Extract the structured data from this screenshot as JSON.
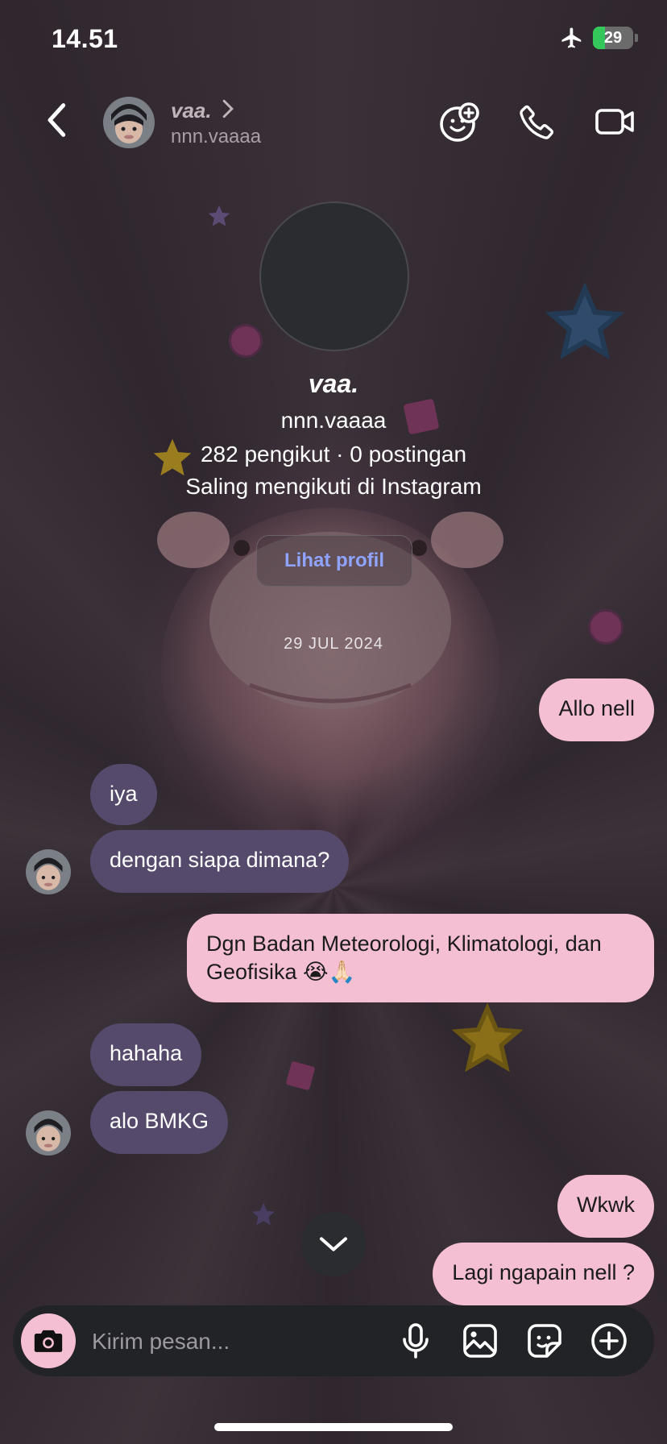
{
  "status_bar": {
    "time": "14.51",
    "battery": "29"
  },
  "header": {
    "name": "vaa.",
    "username": "nnn.vaaaa"
  },
  "profile": {
    "name": "vaa.",
    "username": "nnn.vaaaa",
    "stats": "282 pengikut · 0 postingan",
    "mutual": "Saling mengikuti di Instagram",
    "view_profile_label": "Lihat profil"
  },
  "date_separator": "29 JUL 2024",
  "messages": [
    {
      "sender": "me",
      "text": "Allo nell"
    },
    {
      "sender": "them",
      "text": "iya"
    },
    {
      "sender": "them",
      "text": "dengan siapa dimana?"
    },
    {
      "sender": "me",
      "line1": "Dgn Badan Meteorologi, Klimatologi, dan",
      "line2": "Geofisika 😭🙏🏻"
    },
    {
      "sender": "them",
      "text": "hahaha"
    },
    {
      "sender": "them",
      "text": "alo BMKG"
    },
    {
      "sender": "me",
      "text": "Wkwk"
    },
    {
      "sender": "me",
      "text": "Lagi ngapain nell ?"
    }
  ],
  "composer": {
    "placeholder": "Kirim pesan..."
  },
  "colors": {
    "outgoing_bubble": "#f5bfd3",
    "incoming_bubble": "#554a6b",
    "link_accent": "#8fa3ff"
  },
  "icons": [
    "airplane-icon",
    "back-icon",
    "chevron-right-icon",
    "add-effect-icon",
    "phone-icon",
    "video-icon",
    "chevron-down-icon",
    "camera-icon",
    "microphone-icon",
    "gallery-icon",
    "sticker-icon",
    "plus-circle-icon"
  ]
}
